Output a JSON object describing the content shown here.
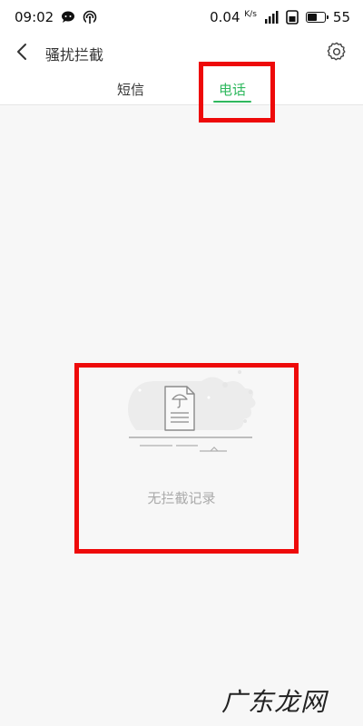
{
  "status_bar": {
    "time": "09:02",
    "net_speed": "0.04",
    "net_speed_unit": "K/s",
    "battery_level": "55",
    "battery_fraction": 0.55
  },
  "header": {
    "title": "骚扰拦截"
  },
  "tabs": [
    {
      "label": "短信",
      "active": false
    },
    {
      "label": "电话",
      "active": true
    }
  ],
  "empty_state": {
    "message": "无拦截记录"
  },
  "watermark": {
    "text": "广东龙网"
  },
  "colors": {
    "accent": "#2fb85e",
    "highlight": "#ee0a0a",
    "background": "#f7f7f7"
  },
  "icons": {
    "back": "chevron-left-icon",
    "settings": "gear-icon",
    "empty": "umbrella-document-icon"
  }
}
